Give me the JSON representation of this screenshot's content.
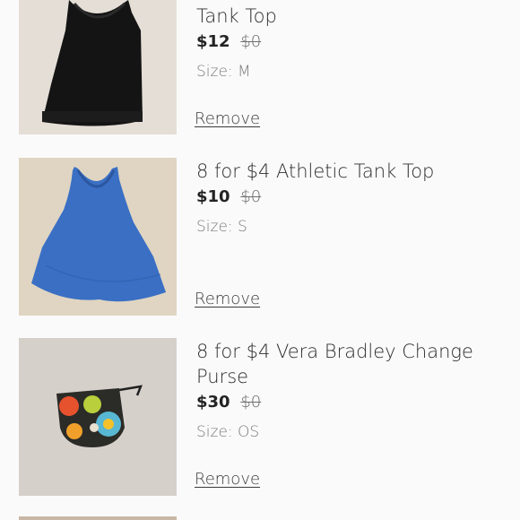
{
  "items": [
    {
      "title": "Tank Top",
      "price": "$12",
      "original_price": "$0",
      "size": "Size: M",
      "remove_label": "Remove",
      "thumb_icon": "black-tank-top-photo"
    },
    {
      "title": "8 for $4 Athletic Tank Top",
      "price": "$10",
      "original_price": "$0",
      "size": "Size: S",
      "remove_label": "Remove",
      "thumb_icon": "blue-tank-top-photo"
    },
    {
      "title": "8 for $4 Vera Bradley Change Purse",
      "price": "$30",
      "original_price": "$0",
      "size": "Size: OS",
      "remove_label": "Remove",
      "thumb_icon": "floral-change-purse-photo"
    }
  ]
}
